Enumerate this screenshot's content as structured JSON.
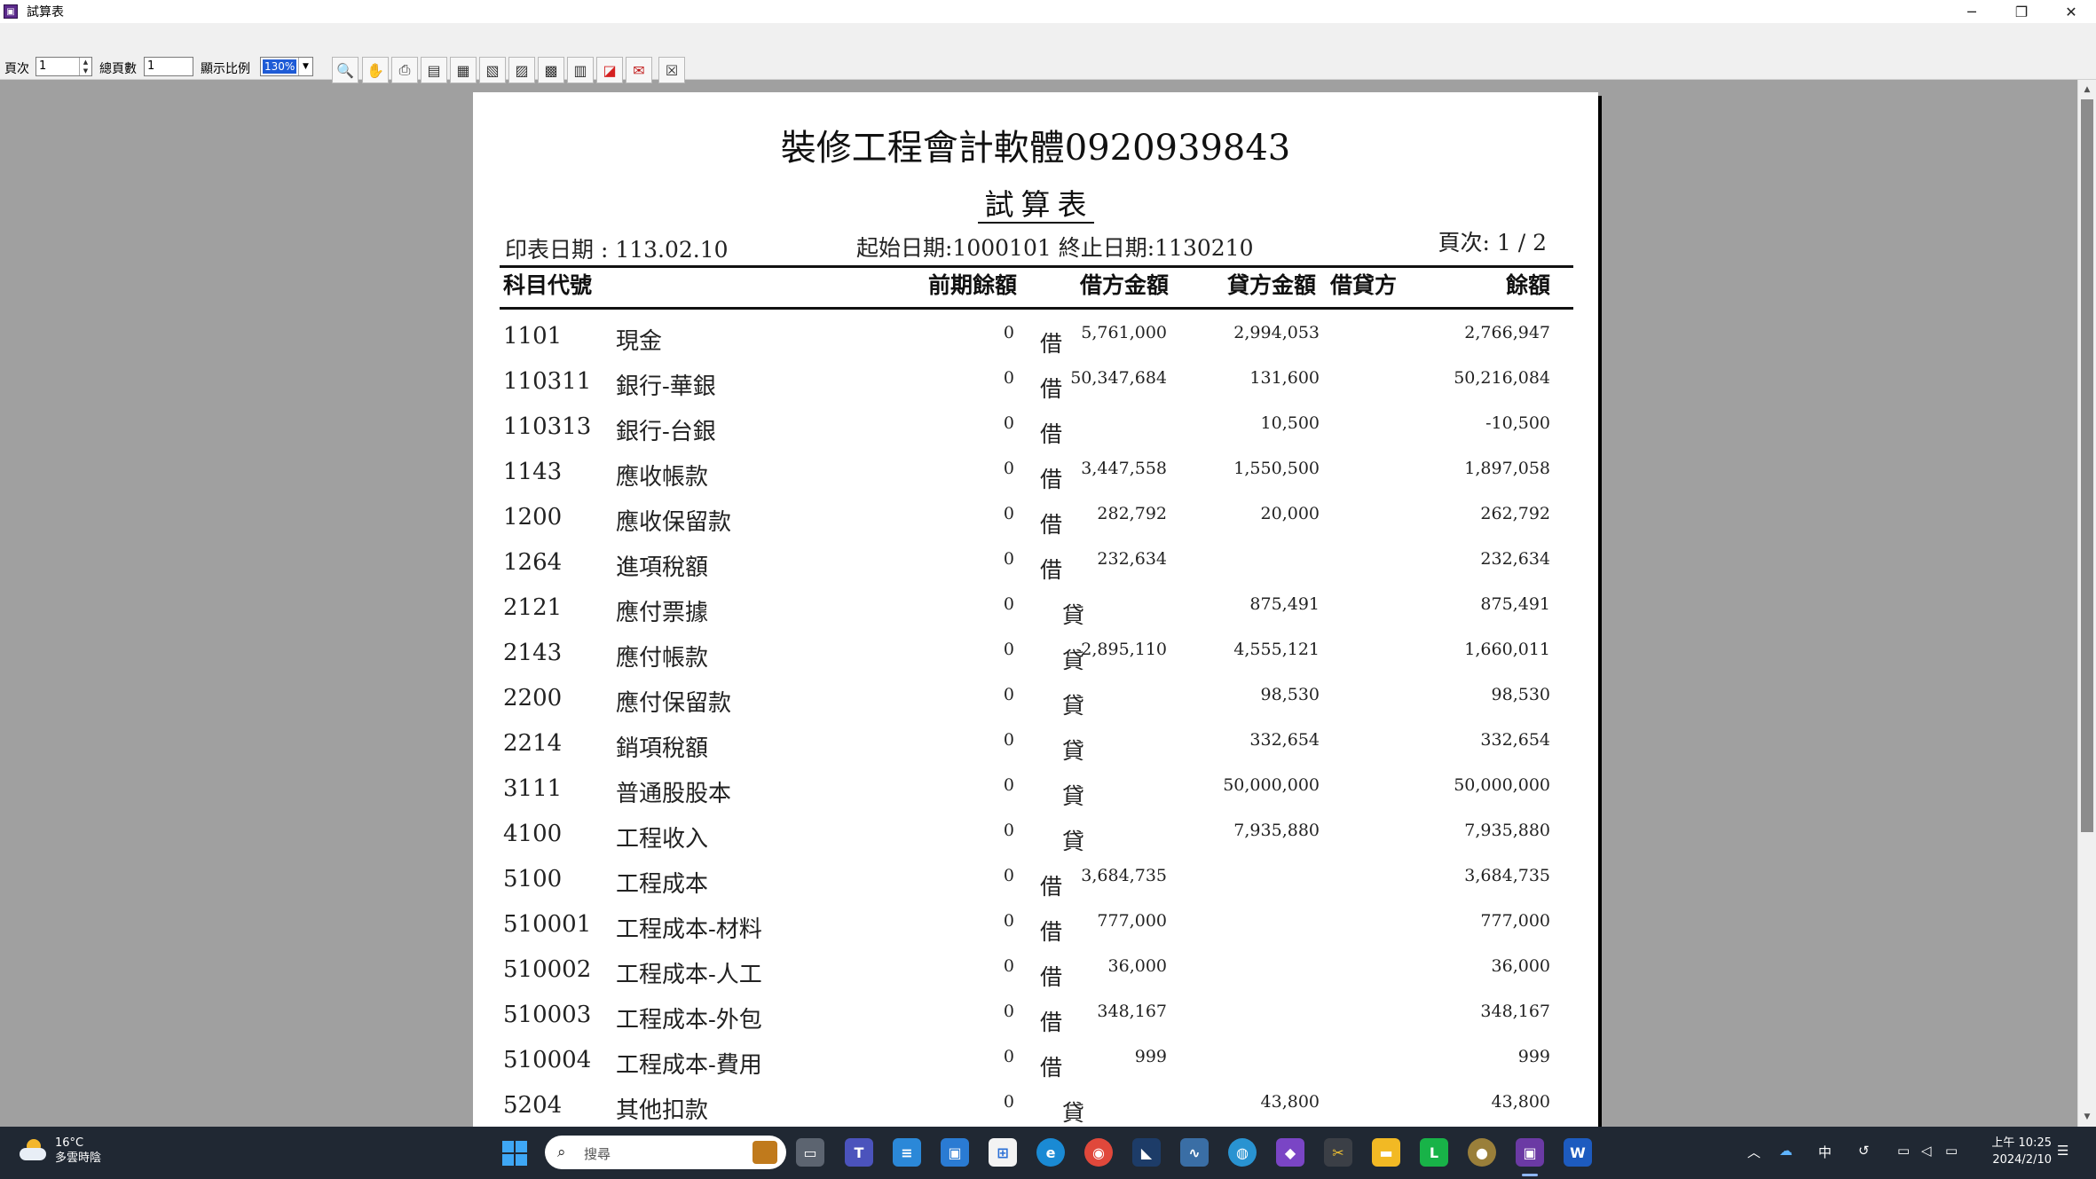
{
  "window": {
    "title": "試算表",
    "minimize": "─",
    "restore": "❐",
    "close": "✕"
  },
  "toolbar": {
    "page_label": "頁次",
    "page_value": "1",
    "total_pages_label": "總頁數",
    "total_pages_value": "1",
    "zoom_label": "顯示比例",
    "zoom_value": "130%",
    "buttons": [
      "zoom-icon",
      "hand-icon",
      "print-icon",
      "page-icon",
      "export-icon",
      "export-icon",
      "export-icon",
      "export-icon",
      "book-icon",
      "pdf-icon",
      "gift-icon",
      "close-icon"
    ]
  },
  "report": {
    "company": "裝修工程會計軟體0920939843",
    "title": "試算表",
    "print_date": "印表日期 : 113.02.10",
    "date_range": "起始日期:1000101 終止日期:1130210",
    "page_no": "頁次: 1 / 2",
    "headers": {
      "code_name": "科目代號",
      "prior": "前期餘額",
      "debit": "借方金額",
      "credit": "貸方金額",
      "dc": "借貸方",
      "balance": "餘額"
    },
    "rows": [
      {
        "code": "1101",
        "name": "現金",
        "prior": "0",
        "debit": "5,761,000",
        "credit": "2,994,053",
        "dc": "借",
        "balance": "2,766,947"
      },
      {
        "code": "110311",
        "name": "銀行-華銀",
        "prior": "0",
        "debit": "50,347,684",
        "credit": "131,600",
        "dc": "借",
        "balance": "50,216,084"
      },
      {
        "code": "110313",
        "name": "銀行-台銀",
        "prior": "0",
        "debit": "",
        "credit": "10,500",
        "dc": "借",
        "balance": "-10,500"
      },
      {
        "code": "1143",
        "name": "應收帳款",
        "prior": "0",
        "debit": "3,447,558",
        "credit": "1,550,500",
        "dc": "借",
        "balance": "1,897,058"
      },
      {
        "code": "1200",
        "name": "應收保留款",
        "prior": "0",
        "debit": "282,792",
        "credit": "20,000",
        "dc": "借",
        "balance": "262,792"
      },
      {
        "code": "1264",
        "name": "進項稅額",
        "prior": "0",
        "debit": "232,634",
        "credit": "",
        "dc": "借",
        "balance": "232,634"
      },
      {
        "code": "2121",
        "name": "應付票據",
        "prior": "0",
        "debit": "",
        "credit": "875,491",
        "dc": "貸",
        "balance": "875,491"
      },
      {
        "code": "2143",
        "name": "應付帳款",
        "prior": "0",
        "debit": "2,895,110",
        "credit": "4,555,121",
        "dc": "貸",
        "balance": "1,660,011"
      },
      {
        "code": "2200",
        "name": "應付保留款",
        "prior": "0",
        "debit": "",
        "credit": "98,530",
        "dc": "貸",
        "balance": "98,530"
      },
      {
        "code": "2214",
        "name": "銷項稅額",
        "prior": "0",
        "debit": "",
        "credit": "332,654",
        "dc": "貸",
        "balance": "332,654"
      },
      {
        "code": "3111",
        "name": "普通股股本",
        "prior": "0",
        "debit": "",
        "credit": "50,000,000",
        "dc": "貸",
        "balance": "50,000,000"
      },
      {
        "code": "4100",
        "name": "工程收入",
        "prior": "0",
        "debit": "",
        "credit": "7,935,880",
        "dc": "貸",
        "balance": "7,935,880"
      },
      {
        "code": "5100",
        "name": "工程成本",
        "prior": "0",
        "debit": "3,684,735",
        "credit": "",
        "dc": "借",
        "balance": "3,684,735"
      },
      {
        "code": "510001",
        "name": "工程成本-材料",
        "prior": "0",
        "debit": "777,000",
        "credit": "",
        "dc": "借",
        "balance": "777,000"
      },
      {
        "code": "510002",
        "name": "工程成本-人工",
        "prior": "0",
        "debit": "36,000",
        "credit": "",
        "dc": "借",
        "balance": "36,000"
      },
      {
        "code": "510003",
        "name": "工程成本-外包",
        "prior": "0",
        "debit": "348,167",
        "credit": "",
        "dc": "借",
        "balance": "348,167"
      },
      {
        "code": "510004",
        "name": "工程成本-費用",
        "prior": "0",
        "debit": "999",
        "credit": "",
        "dc": "借",
        "balance": "999"
      },
      {
        "code": "5204",
        "name": "其他扣款",
        "prior": "0",
        "debit": "",
        "credit": "43,800",
        "dc": "貸",
        "balance": "43,800"
      }
    ]
  },
  "taskbar": {
    "weather_temp": "16°C",
    "weather_desc": "多雲時陰",
    "search_placeholder": "搜尋",
    "apps": [
      "task-view",
      "teams",
      "notepad",
      "remote-desktop",
      "store",
      "edge",
      "chrome",
      "visual-studio-code",
      "performance-monitor",
      "network-browser",
      "visual-studio",
      "tools",
      "file-explorer",
      "line",
      "game",
      "trial-balance-app",
      "word"
    ],
    "ime": "中",
    "clock_time": "上午 10:25",
    "clock_date": "2024/2/10"
  }
}
